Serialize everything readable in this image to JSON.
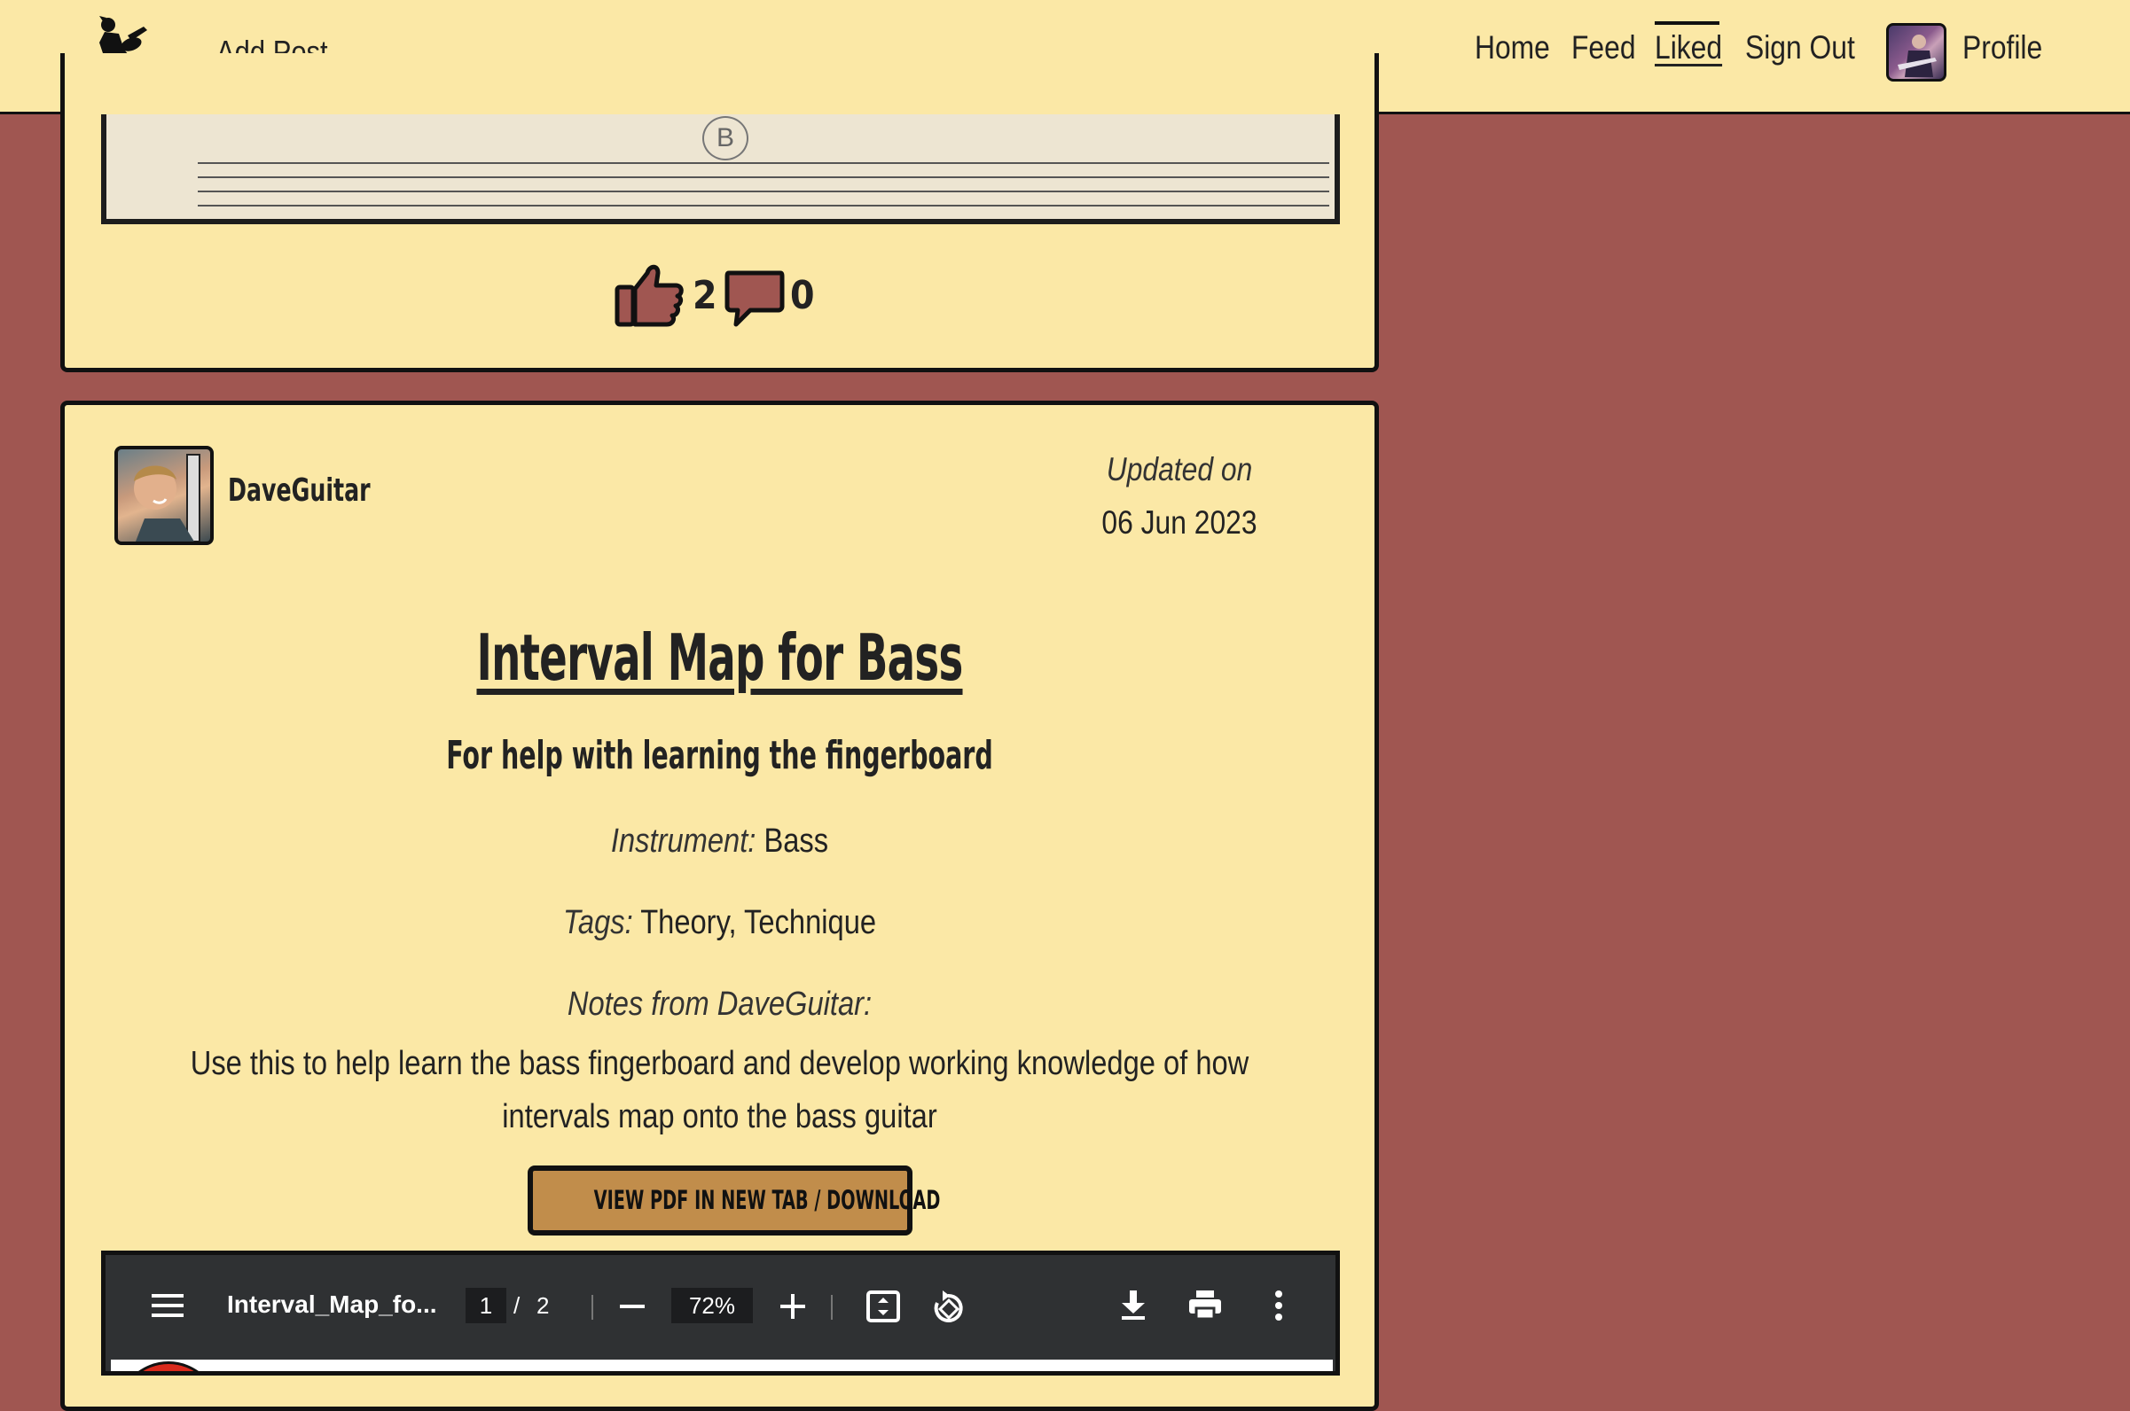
{
  "nav": {
    "add_post": "Add Post",
    "home": "Home",
    "feed": "Feed",
    "liked": "Liked",
    "sign_out": "Sign Out",
    "profile": "Profile"
  },
  "previous_post": {
    "sheet_note": "B",
    "likes": "2",
    "comments": "0"
  },
  "post": {
    "author": "DaveGuitar",
    "updated_label": "Updated on",
    "updated_date": "06 Jun 2023",
    "title": "Interval Map for Bass",
    "subtitle": "For help with learning the fingerboard",
    "instrument_label": "Instrument:",
    "instrument": "Bass",
    "tags_label": "Tags:",
    "tags": "Theory, Technique",
    "notes_label": "Notes from DaveGuitar:",
    "notes": "Use this to help learn the bass fingerboard and develop working knowledge of how intervals map onto the bass guitar",
    "pdf_button": "VIEW PDF IN NEW TAB / DOWNLOAD"
  },
  "pdf_viewer": {
    "filename": "Interval_Map_fo...",
    "current_page": "1",
    "page_sep": "/",
    "total_pages": "2",
    "zoom": "72%"
  },
  "colors": {
    "background": "#a05651",
    "card": "#fbe8a6",
    "button": "#c18d4b",
    "pdf_toolbar": "#2f3133"
  }
}
